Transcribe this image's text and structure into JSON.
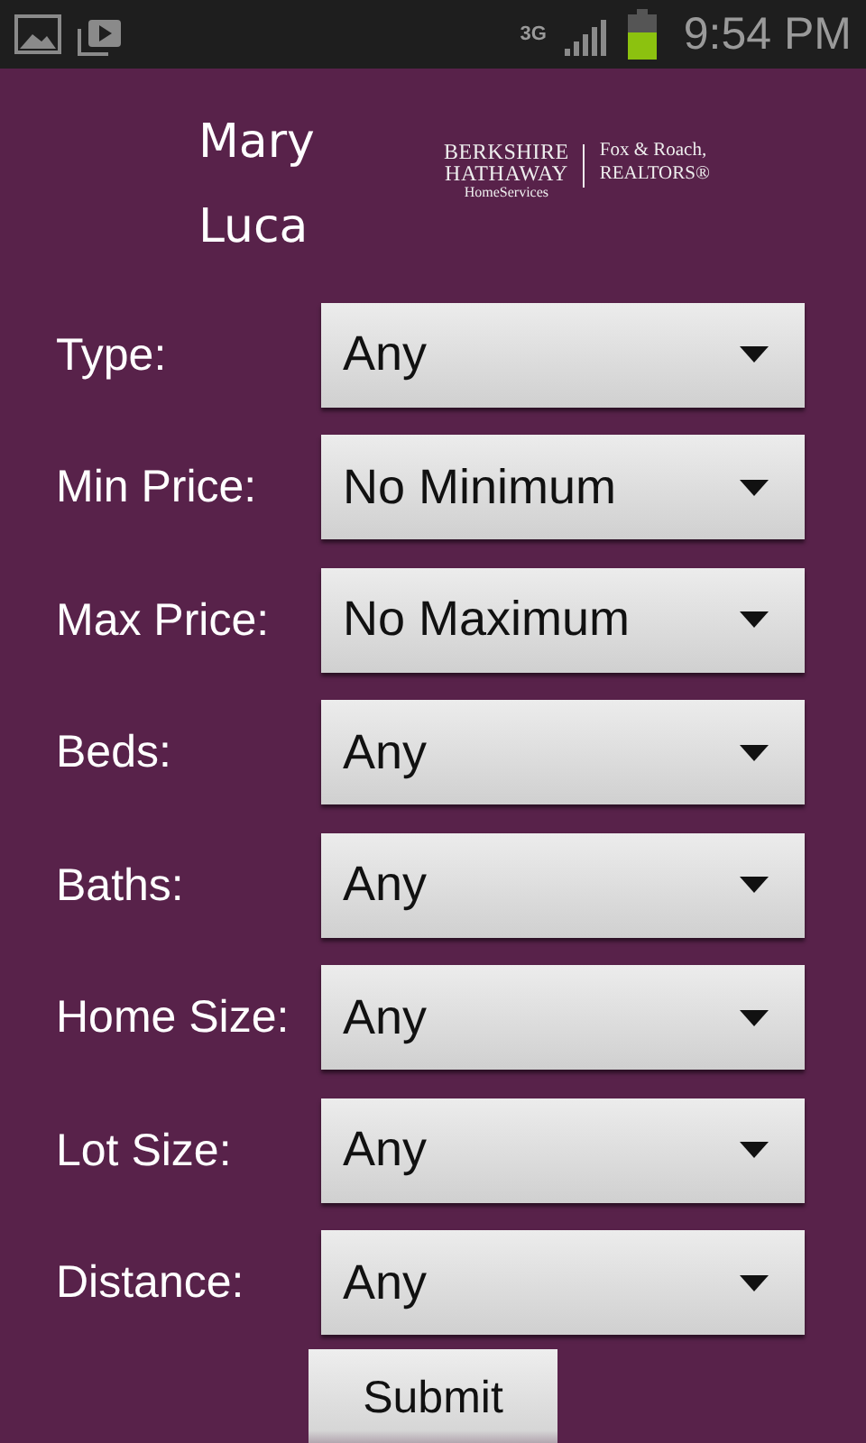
{
  "status_bar": {
    "time": "9:54 PM",
    "network": "3G"
  },
  "header": {
    "agent_name": [
      "Mary",
      "Luca"
    ],
    "logo": {
      "line_1": "BERKSHIRE",
      "line_2": "HATHAWAY",
      "line_3": "HomeServices",
      "right_1": "Fox & Roach,",
      "right_2": "REALTORS®"
    }
  },
  "form": [
    {
      "label": "Type:",
      "value": "Any"
    },
    {
      "label": "Min Price:",
      "value": "No Minimum"
    },
    {
      "label": "Max Price:",
      "value": "No Maximum"
    },
    {
      "label": "Beds:",
      "value": "Any"
    },
    {
      "label": "Baths:",
      "value": "Any"
    },
    {
      "label": "Home Size:",
      "value": "Any"
    },
    {
      "label": "Lot Size:",
      "value": "Any"
    },
    {
      "label": "Distance:",
      "value": "Any"
    }
  ],
  "submit": "Submit"
}
